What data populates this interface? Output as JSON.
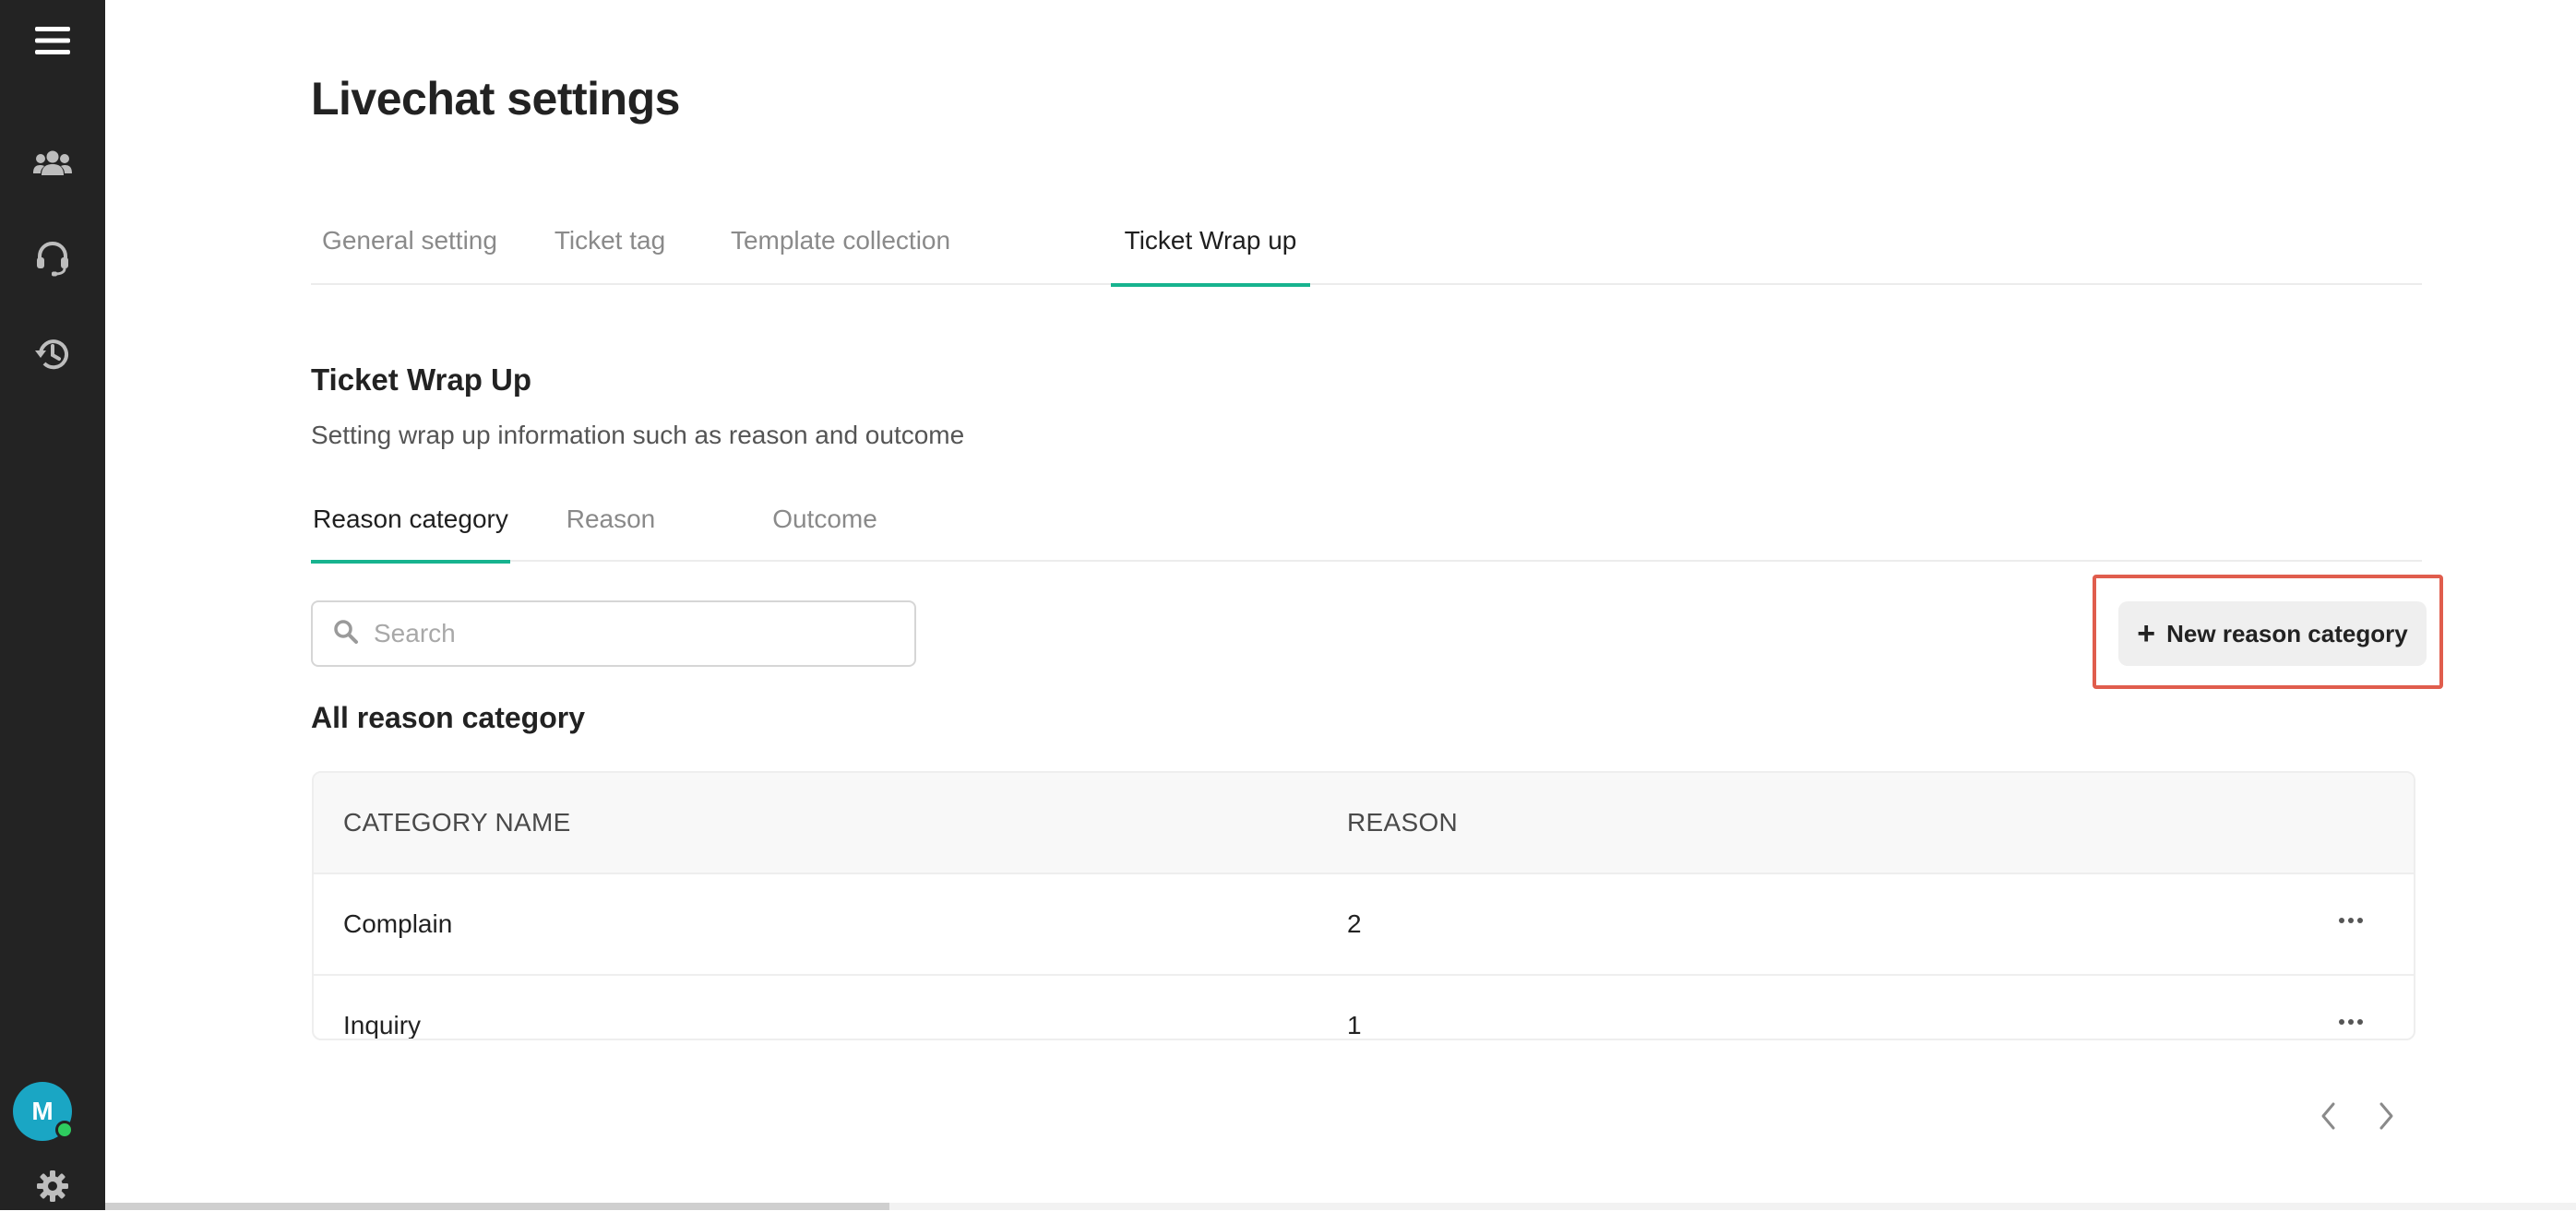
{
  "page": {
    "title": "Livechat settings"
  },
  "tabs": [
    {
      "label": "General setting"
    },
    {
      "label": "Ticket tag"
    },
    {
      "label": "Template collection"
    },
    {
      "label": "Ticket Wrap up"
    }
  ],
  "active_tab": "Ticket Wrap up",
  "section": {
    "title": "Ticket Wrap Up",
    "description": "Setting wrap up information such as reason and outcome"
  },
  "subtabs": [
    {
      "label": "Reason category"
    },
    {
      "label": "Reason"
    },
    {
      "label": "Outcome"
    }
  ],
  "active_subtab": "Reason category",
  "search": {
    "placeholder": "Search",
    "value": ""
  },
  "actions": {
    "new_reason_category": "New reason category"
  },
  "list": {
    "title": "All reason category",
    "columns": [
      "CATEGORY NAME",
      "REASON"
    ],
    "rows": [
      {
        "name": "Complain",
        "reason": "2"
      },
      {
        "name": "Inquiry",
        "reason": "1"
      }
    ]
  },
  "user": {
    "initial": "M",
    "status": "online"
  },
  "icons": {
    "sidebar": [
      "menu-icon",
      "contacts-icon",
      "headset-icon",
      "history-icon",
      "gear-icon"
    ],
    "search": "search-icon",
    "row_actions": "more-horizontal-icon",
    "pagination": [
      "chevron-left-icon",
      "chevron-right-icon"
    ]
  },
  "colors": {
    "sidebar_bg": "#232323",
    "accent": "#17b38f",
    "highlight": "#e05d4d",
    "avatar_bg": "#1aa6c4",
    "status_online": "#2ecc5f"
  }
}
